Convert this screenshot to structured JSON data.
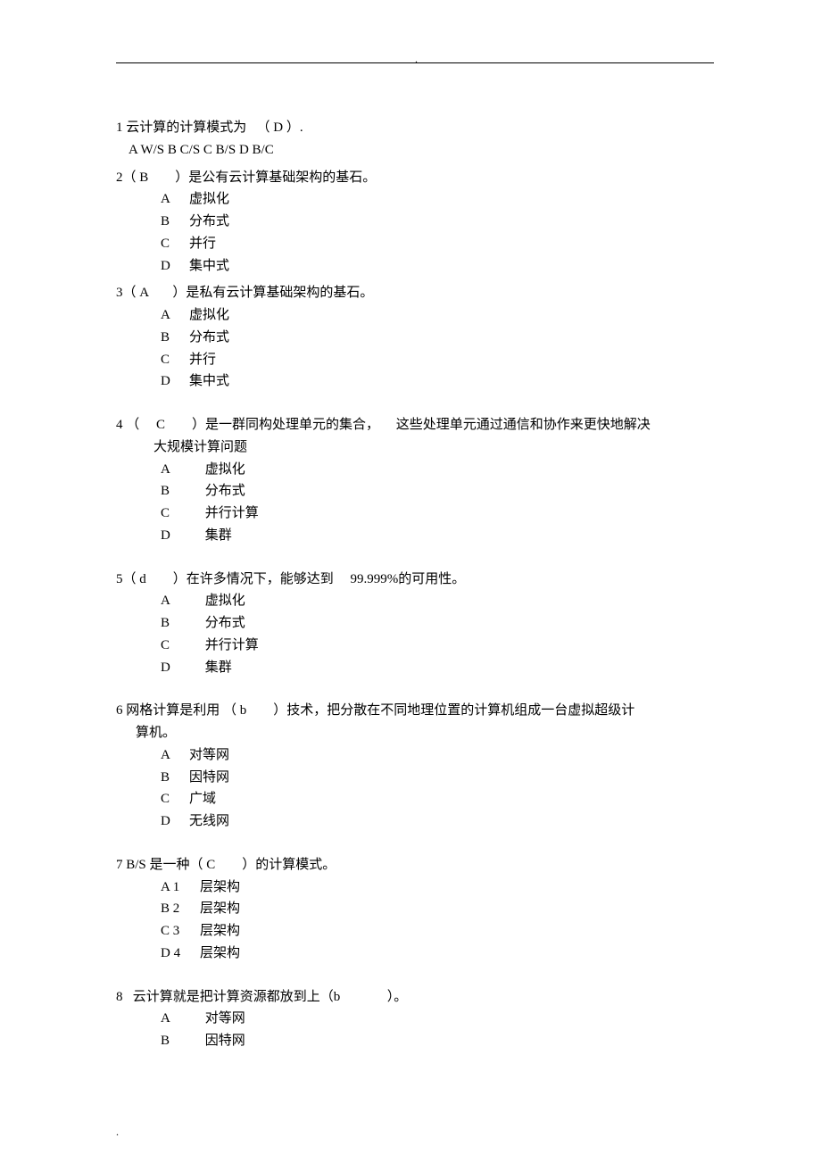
{
  "q1": {
    "text_a": "1 云计算的计算模式为",
    "text_b": "（  D   ）.",
    "opts": "A W/S    B C/S     C B/S    D B/C"
  },
  "q2": {
    "text_a": "2（   B",
    "text_b": "）是公有云计算基础架构的基石。",
    "opts": [
      {
        "l": "A",
        "t": "虚拟化"
      },
      {
        "l": "B",
        "t": "分布式"
      },
      {
        "l": "C",
        "t": "并行"
      },
      {
        "l": "D",
        "t": "集中式"
      }
    ]
  },
  "q3": {
    "text_a": "3（  A",
    "text_b": "）是私有云计算基础架构的基石。",
    "opts": [
      {
        "l": "A",
        "t": "虚拟化"
      },
      {
        "l": "B",
        "t": "分布式"
      },
      {
        "l": "C",
        "t": "并行"
      },
      {
        "l": "D",
        "t": "集中式"
      }
    ]
  },
  "q4": {
    "text_a": "4 （",
    "text_b": "C",
    "text_c": "）是一群同构处理单元的集合，",
    "text_d": "这些处理单元通过通信和协作来更快地解决",
    "cont": "大规模计算问题",
    "opts": [
      {
        "l": "A",
        "t": "虚拟化"
      },
      {
        "l": "B",
        "t": "分布式"
      },
      {
        "l": "C",
        "t": "并行计算"
      },
      {
        "l": "D",
        "t": "集群"
      }
    ]
  },
  "q5": {
    "text_a": "5（   d",
    "text_b": "）在许多情况下，能够达到",
    "text_c": "99.999%的可用性。",
    "opts": [
      {
        "l": "A",
        "t": "虚拟化"
      },
      {
        "l": "B",
        "t": "分布式"
      },
      {
        "l": "C",
        "t": "并行计算"
      },
      {
        "l": "D",
        "t": "集群"
      }
    ]
  },
  "q6": {
    "text_a": "6 网格计算是利用 （  b",
    "text_b": "）技术，把分散在不同地理位置的计算机组成一台虚拟超级计",
    "cont": "算机。",
    "opts": [
      {
        "l": "A",
        "t": "对等网"
      },
      {
        "l": "B",
        "t": "因特网"
      },
      {
        "l": "C",
        "t": "广域"
      },
      {
        "l": "D",
        "t": "无线网"
      }
    ]
  },
  "q7": {
    "text_a": "7 B/S   是一种（  C",
    "text_b": "）的计算模式。",
    "opts": [
      {
        "l": "A 1",
        "t": "层架构"
      },
      {
        "l": "B 2",
        "t": "层架构"
      },
      {
        "l": "C 3",
        "t": "层架构"
      },
      {
        "l": "D 4",
        "t": "层架构"
      }
    ]
  },
  "q8": {
    "text_a": "8",
    "text_b": "云计算就是把计算资源都放到上（b",
    "text_c": "）。",
    "opts": [
      {
        "l": "A",
        "t": "对等网"
      },
      {
        "l": "B",
        "t": "因特网"
      }
    ]
  },
  "marks": {
    "top": ".",
    "bottom": "."
  }
}
